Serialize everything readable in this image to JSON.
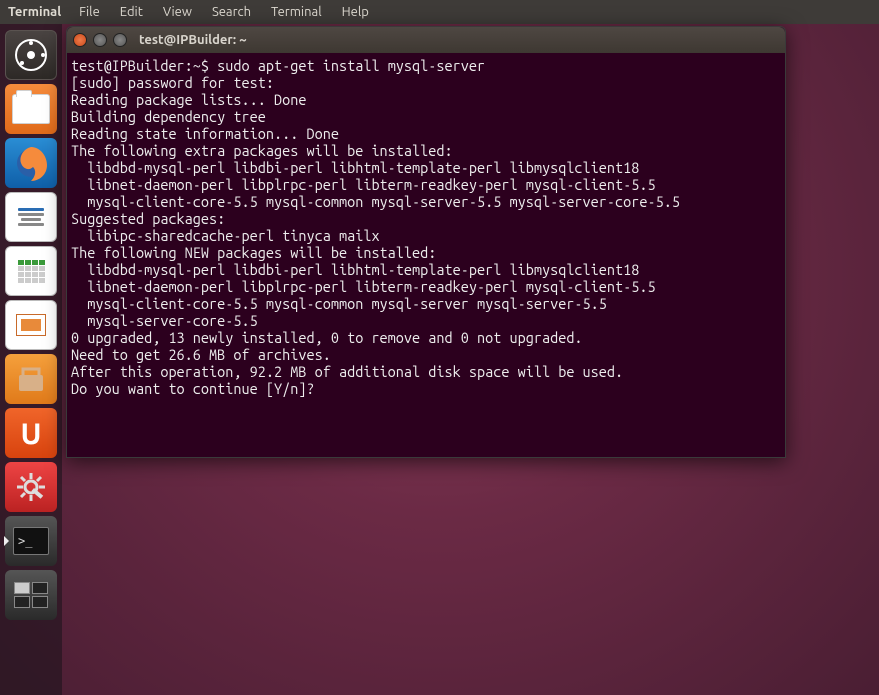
{
  "menubar": {
    "app_name": "Terminal",
    "items": [
      "File",
      "Edit",
      "View",
      "Search",
      "Terminal",
      "Help"
    ]
  },
  "launcher": {
    "icons": [
      {
        "name": "dash-home-icon"
      },
      {
        "name": "files-icon"
      },
      {
        "name": "firefox-icon"
      },
      {
        "name": "libreoffice-writer-icon"
      },
      {
        "name": "libreoffice-calc-icon"
      },
      {
        "name": "libreoffice-impress-icon"
      },
      {
        "name": "ubuntu-software-center-icon"
      },
      {
        "name": "ubuntu-one-icon"
      },
      {
        "name": "system-settings-icon"
      },
      {
        "name": "terminal-icon"
      },
      {
        "name": "workspace-switcher-icon"
      }
    ]
  },
  "window": {
    "title": "test@IPBuilder: ~",
    "prompt": "test@IPBuilder:~$ ",
    "command": "sudo apt-get install mysql-server",
    "lines": [
      "[sudo] password for test:",
      "Reading package lists... Done",
      "Building dependency tree",
      "Reading state information... Done",
      "The following extra packages will be installed:",
      "  libdbd-mysql-perl libdbi-perl libhtml-template-perl libmysqlclient18",
      "  libnet-daemon-perl libplrpc-perl libterm-readkey-perl mysql-client-5.5",
      "  mysql-client-core-5.5 mysql-common mysql-server-5.5 mysql-server-core-5.5",
      "Suggested packages:",
      "  libipc-sharedcache-perl tinyca mailx",
      "The following NEW packages will be installed:",
      "  libdbd-mysql-perl libdbi-perl libhtml-template-perl libmysqlclient18",
      "  libnet-daemon-perl libplrpc-perl libterm-readkey-perl mysql-client-5.5",
      "  mysql-client-core-5.5 mysql-common mysql-server mysql-server-5.5",
      "  mysql-server-core-5.5",
      "0 upgraded, 13 newly installed, 0 to remove and 0 not upgraded.",
      "Need to get 26.6 MB of archives.",
      "After this operation, 92.2 MB of additional disk space will be used.",
      "Do you want to continue [Y/n]?"
    ]
  }
}
